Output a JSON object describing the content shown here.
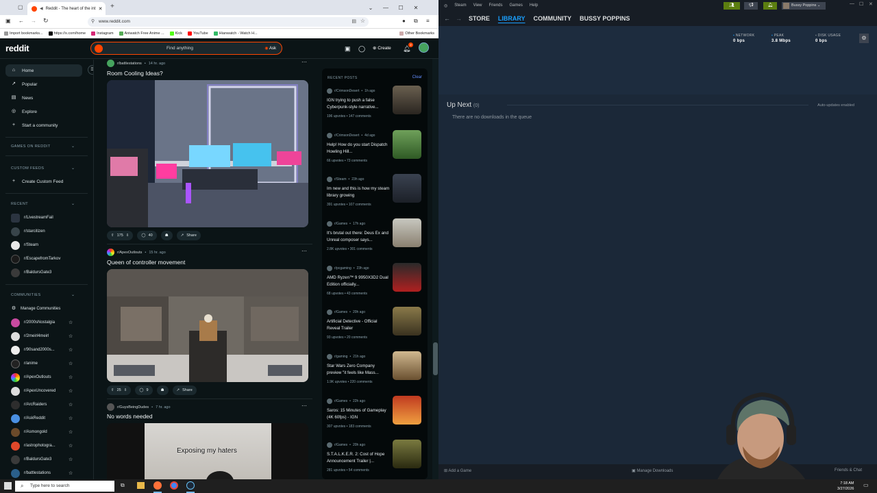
{
  "browser": {
    "tab_title": "Reddit - The heart of the int",
    "url": "www.reddit.com",
    "bookmarks": [
      "Import bookmarks...",
      "https://x.com/home",
      "Instagram",
      "Aniwatch Free Anime ...",
      "Kick",
      "YouTube",
      "Hianwatch - Watch H..."
    ],
    "other_bookmarks": "Other Bookmarks"
  },
  "reddit": {
    "logo": "reddit",
    "search_placeholder": "Find anything",
    "ask_label": "Ask",
    "create_label": "Create",
    "notif_count": "2",
    "sidebar": {
      "nav": [
        "Home",
        "Popular",
        "News",
        "Explore",
        "Start a community"
      ],
      "games_header": "GAMES ON REDDIT",
      "custom_header": "CUSTOM FEEDS",
      "create_custom_feed": "Create Custom Feed",
      "recent_header": "RECENT",
      "recent": [
        "r/LivestreamFail",
        "r/starcitizen",
        "r/Steam",
        "r/EscapefromTarkov",
        "r/BaldursGate3"
      ],
      "communities_header": "COMMUNITIES",
      "manage_communities": "Manage Communities",
      "communities": [
        "r/2000sNostalgia",
        "r/2meirl4meirl",
        "r/90sand2000s...",
        "r/anime",
        "r/ApexOutlouts",
        "r/ApexUncovered",
        "r/ArcRaiders",
        "r/AskReddit",
        "r/Asmongold",
        "r/astrophotogra...",
        "r/BaldursGate3",
        "r/battlestations"
      ]
    },
    "posts": [
      {
        "sub": "r/battlestations",
        "time": "14 hr. ago",
        "title": "Room Cooling Ideas?",
        "votes": "175",
        "comments": "40",
        "share": "Share"
      },
      {
        "sub": "r/ApexOutlouts",
        "time": "15 hr. ago",
        "title": "Queen of controller movement",
        "votes": "25",
        "comments": "9",
        "share": "Share"
      },
      {
        "sub": "r/GuysBeingDudes",
        "time": "7 hr. ago",
        "title": "No words needed",
        "caption": "Exposing my haters"
      }
    ],
    "recent_posts": {
      "header": "RECENT POSTS",
      "clear": "Clear",
      "items": [
        {
          "sub": "r/CrimsonDesert",
          "time": "1h ago",
          "title": "IGN trying to push a false Cyberpunk-style narrative...",
          "upvotes": "196 upvotes",
          "comments": "147 comments"
        },
        {
          "sub": "r/CrimsonDesert",
          "time": "4d ago",
          "title": "Help! How do you start Dispatch Howling Hill...",
          "upvotes": "66 upvotes",
          "comments": "73 comments"
        },
        {
          "sub": "r/Steam",
          "time": "23h ago",
          "title": "Im new and this is how my steam library growing",
          "upvotes": "391 upvotes",
          "comments": "107 comments"
        },
        {
          "sub": "r/Games",
          "time": "17h ago",
          "title": "It's brutal out there: Deus Ex and Unreal composer says...",
          "upvotes": "2.8K upvotes",
          "comments": "301 comments"
        },
        {
          "sub": "r/pcgaming",
          "time": "23h ago",
          "title": "AMD Ryzen™ 9 9950X3D2 Dual Edition officially...",
          "upvotes": "68 upvotes",
          "comments": "43 comments"
        },
        {
          "sub": "r/Games",
          "time": "20h ago",
          "title": "Artificial Detective - Official Reveal Trailer",
          "upvotes": "93 upvotes",
          "comments": "20 comments"
        },
        {
          "sub": "r/gaming",
          "time": "21h ago",
          "title": "Star Wars Zero Company preview \"it feels like Mass...",
          "upvotes": "1.9K upvotes",
          "comments": "220 comments"
        },
        {
          "sub": "r/Games",
          "time": "22h ago",
          "title": "Saros: 15 Minutes of Gameplay (4K 60fps) - IGN",
          "upvotes": "307 upvotes",
          "comments": "183 comments"
        },
        {
          "sub": "r/Games",
          "time": "20h ago",
          "title": "S.T.A.L.K.E.R. 2: Cost of Hope Announcement Trailer |...",
          "upvotes": "281 upvotes",
          "comments": "54 comments"
        }
      ]
    }
  },
  "steam": {
    "menu": [
      "Steam",
      "View",
      "Friends",
      "Games",
      "Help"
    ],
    "tabs": [
      "STORE",
      "LIBRARY",
      "COMMUNITY",
      "BUSSY POPPINS"
    ],
    "username": "Bussy Poppins",
    "network_label": "NETWORK",
    "network_value": "0 bps",
    "peak_label": "PEAK",
    "peak_value": "3.8 Mbps",
    "disk_label": "DISK USAGE",
    "disk_value": "0 bps",
    "up_next": "Up Next",
    "up_next_count": "(0)",
    "auto_updates": "Auto-updates enabled",
    "empty_queue": "There are no downloads in the queue",
    "add_game": "Add a Game",
    "manage_downloads": "Manage Downloads",
    "friends_chat": "Friends & Chat"
  },
  "taskbar": {
    "search_placeholder": "Type here to search",
    "time": "7:18 AM",
    "date": "3/27/2026"
  }
}
